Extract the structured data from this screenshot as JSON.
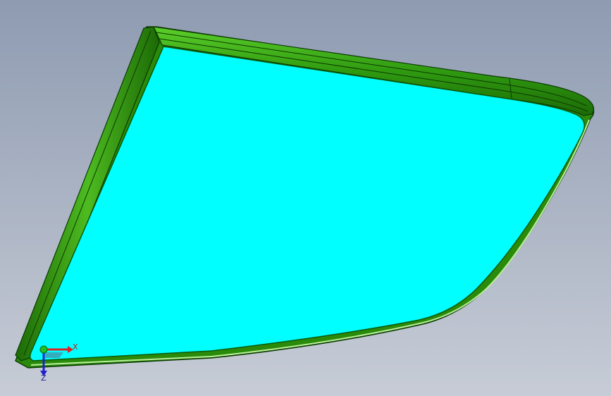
{
  "viewport": {
    "background_top": "#8e9bb1",
    "background_bottom": "#c7ccd6"
  },
  "model": {
    "glass_color": "#00ffff",
    "seal_color": "#2a8a0a",
    "seal_highlight": "#5ccf2a",
    "seal_edge": "#0c3a02"
  },
  "triad": {
    "x_label": "X",
    "z_label": "Z",
    "x_color": "#e02020",
    "y_color": "#20c020",
    "z_color": "#2020d0"
  }
}
